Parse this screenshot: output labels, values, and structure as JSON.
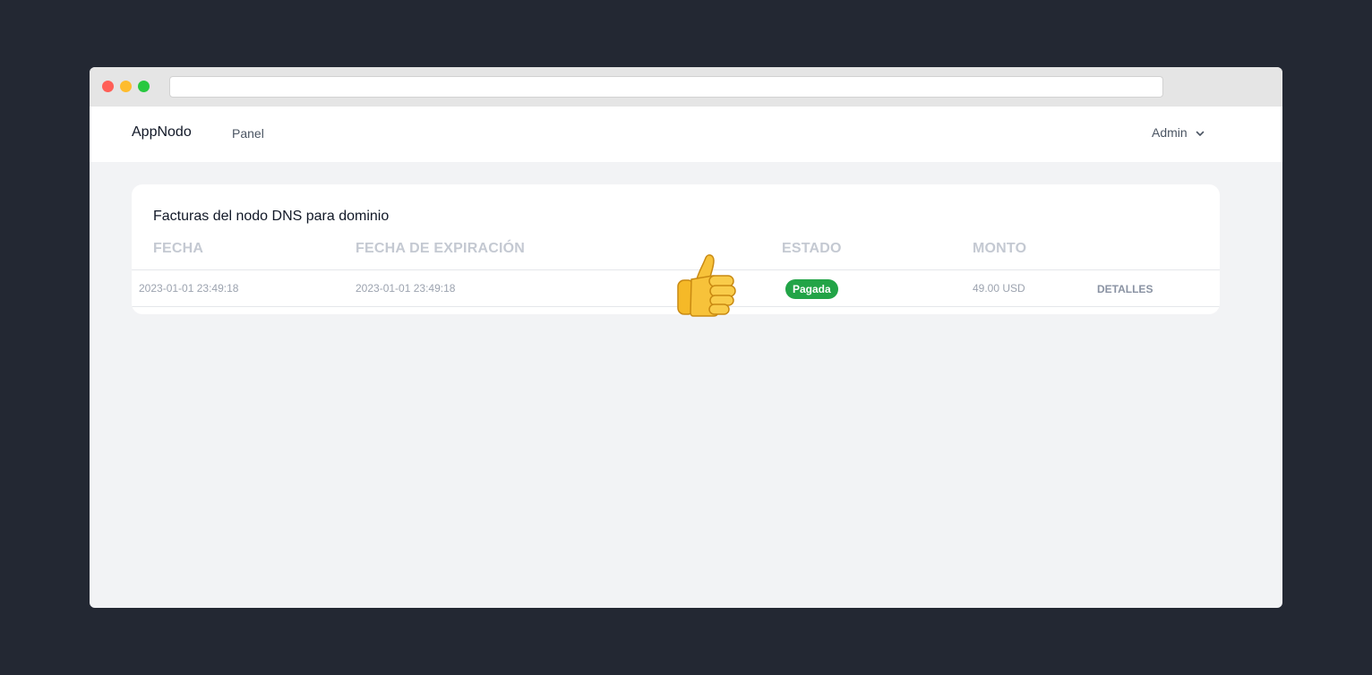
{
  "navbar": {
    "brand": "AppNodo",
    "link_panel": "Panel",
    "user_label": "Admin"
  },
  "invoices": {
    "title": "Facturas del nodo DNS para dominio",
    "columns": [
      "FECHA",
      "FECHA DE EXPIRACIÓN",
      "ESTADO",
      "MONTO"
    ],
    "rows": [
      {
        "date": "2023-01-01 23:49:18",
        "expiration": "2023-01-01 23:49:18",
        "status": "Pagada",
        "amount": "49.00 USD",
        "action": "DETALLES"
      }
    ]
  },
  "colors": {
    "status_paid": "#22a447",
    "background": "#232833"
  },
  "icons": {
    "overlay": "thumbs-up-icon",
    "user_menu": "chevron-down-icon"
  }
}
